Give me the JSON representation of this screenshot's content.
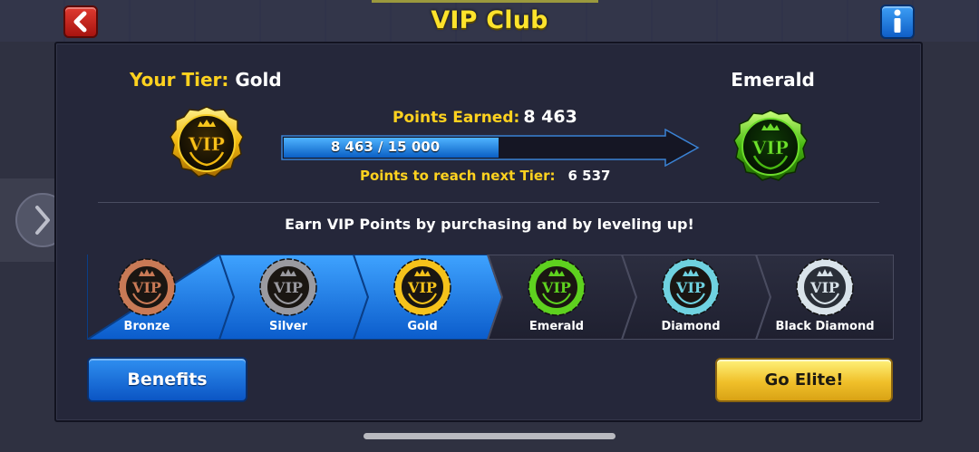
{
  "header": {
    "title": "VIP Club",
    "back_icon": "chevron-left-icon",
    "info_icon": "info-icon"
  },
  "current_tier": {
    "label": "Your Tier:",
    "value": "Gold"
  },
  "next_tier": {
    "name": "Emerald"
  },
  "points": {
    "earned_label": "Points Earned:",
    "earned_value": "8 463",
    "progress_text": "8 463 / 15 000",
    "progress_fraction": 0.5642,
    "to_next_label": "Points to reach next Tier:",
    "to_next_value": "6 537"
  },
  "info_text": "Earn VIP Points by purchasing and by leveling up!",
  "tiers": [
    {
      "name": "Bronze",
      "achieved": true
    },
    {
      "name": "Silver",
      "achieved": true
    },
    {
      "name": "Gold",
      "achieved": true
    },
    {
      "name": "Emerald",
      "achieved": false
    },
    {
      "name": "Diamond",
      "achieved": false
    },
    {
      "name": "Black Diamond",
      "achieved": false
    }
  ],
  "badge_text": "VIP",
  "buttons": {
    "benefits": "Benefits",
    "go_elite": "Go Elite!"
  },
  "colors": {
    "accent_yellow": "#ffd21f",
    "progress_blue": "#2b8de6",
    "gold_badge": "#f5c21b",
    "emerald_badge": "#5ed11f",
    "bronze_badge": "#c97a56",
    "silver_badge": "#9a9aa0",
    "diamond_badge": "#6fd2e0",
    "black_diamond_badge": "#d9e3ea"
  }
}
